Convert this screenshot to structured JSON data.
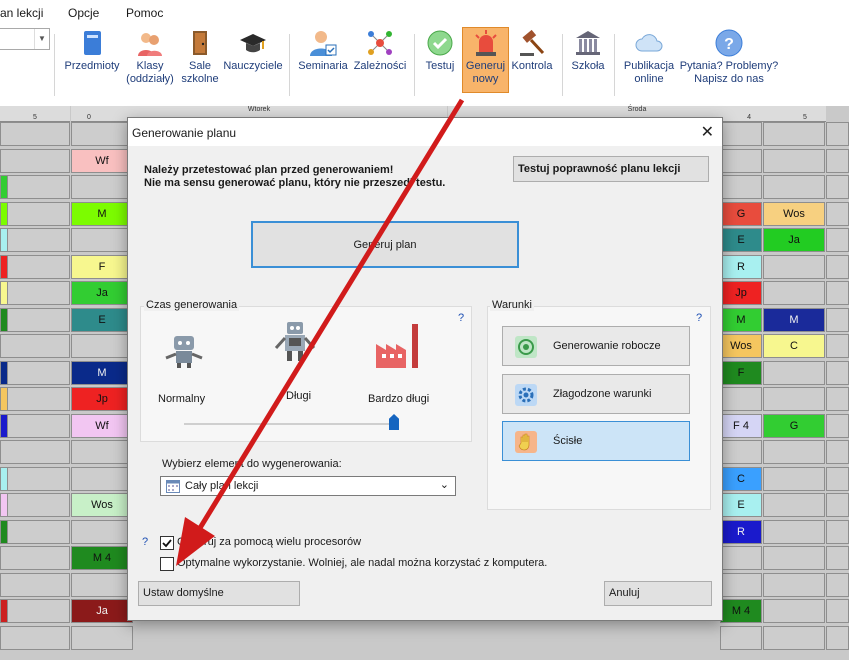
{
  "menubar": {
    "items": [
      "an lekcji",
      "Opcje",
      "Pomoc"
    ]
  },
  "ribbon": {
    "buttons": [
      {
        "label": "Przedmioty",
        "icon": "book-icon"
      },
      {
        "label": "Klasy\n(oddziały)",
        "icon": "students-icon"
      },
      {
        "label": "Sale\nszkolne",
        "icon": "door-icon"
      },
      {
        "label": "Nauczyciele",
        "icon": "graduation-cap-icon"
      },
      {
        "label": "Seminaria",
        "icon": "person-check-icon"
      },
      {
        "label": "Zależności",
        "icon": "network-icon"
      },
      {
        "label": "Testuj",
        "icon": "check-circle-icon"
      },
      {
        "label": "Generuj\nnowy",
        "icon": "alarm-light-icon"
      },
      {
        "label": "Kontrola",
        "icon": "gavel-icon"
      },
      {
        "label": "Szkoła",
        "icon": "building-icon"
      },
      {
        "label": "Publikacja\nonline",
        "icon": "cloud-icon"
      },
      {
        "label": "Pytania? Problemy?\nNapisz do nas",
        "icon": "question-icon"
      }
    ]
  },
  "grid": {
    "day_headers": [
      "Wtorek",
      "Środa"
    ],
    "period_headers": [
      "5",
      "0",
      "4",
      "5"
    ]
  },
  "cells_left": [
    {
      "text": "Wf",
      "color": "#f9c0c0"
    },
    {
      "text": "M",
      "color": "#7cfc00"
    },
    {
      "text": "F",
      "color": "#f7f78f"
    },
    {
      "text": "Ja",
      "color": "#32cd32"
    },
    {
      "text": "E",
      "color": "#2e8b8b"
    },
    {
      "text": "M",
      "color": "#0a2a8a"
    },
    {
      "text": "Jp",
      "color": "#ee2222"
    },
    {
      "text": "Wf",
      "color": "#f2c6f2"
    },
    {
      "text": "Wos",
      "color": "#c8f0c8"
    },
    {
      "text": "M 4",
      "color": "#1f8a1f"
    },
    {
      "text": "Ja",
      "color": "#8b1a1a"
    }
  ],
  "cells_right_a": [
    {
      "text": "G",
      "color": "#e84c3d"
    },
    {
      "text": "E",
      "color": "#2e8b8b"
    },
    {
      "text": "R",
      "color": "#a8f0f0"
    },
    {
      "text": "Jp",
      "color": "#ee2222"
    },
    {
      "text": "M",
      "color": "#32cd32"
    },
    {
      "text": "Wos",
      "color": "#f5c65f"
    },
    {
      "text": "F",
      "color": "#1f8a1f"
    },
    {
      "text": "F 4",
      "color": "#d5d5f5"
    },
    {
      "text": "C",
      "color": "#3aa0ff"
    },
    {
      "text": "E",
      "color": "#a8f0f0"
    },
    {
      "text": "R",
      "color": "#1a1acc"
    },
    {
      "text": "M 4",
      "color": "#1f8a1f"
    }
  ],
  "cells_right_b": [
    {
      "text": "Wos",
      "color": "#f7d080"
    },
    {
      "text": "Ja",
      "color": "#22cc22"
    },
    {
      "text": "M",
      "color": "#1a2a9a"
    },
    {
      "text": "C",
      "color": "#f7f78f"
    },
    {
      "text": "G",
      "color": "#32cd32"
    }
  ],
  "dialog": {
    "title": "Generowanie planu",
    "warning_line1": "Należy przetestować plan przed generowaniem!",
    "warning_line2": "Nie ma sensu generować planu, który nie przeszedł testu.",
    "test_button": "Testuj poprawność planu lekcji",
    "generate_button": "Generuj plan",
    "time_group": {
      "label": "Czas generowania",
      "help": "?",
      "options": [
        "Normalny",
        "Długi",
        "Bardzo długi"
      ],
      "selected_level": 1.0
    },
    "conditions_group": {
      "label": "Warunki",
      "help": "?",
      "options": [
        "Generowanie robocze",
        "Złagodzone warunki",
        "Ścisłe"
      ],
      "selected": "Ścisłe"
    },
    "element_label": "Wybierz element do wygenerowania:",
    "element_value": "Cały plan lekcji",
    "multi_cpu_help": "?",
    "multi_cpu_label": "Generuj za pomocą wielu procesorów",
    "multi_cpu_checked": true,
    "optimal_label": "Optymalne wykorzystanie. Wolniej, ale nadal można korzystać z komputera.",
    "optimal_checked": false,
    "defaults_button": "Ustaw domyślne",
    "cancel_button": "Anuluj"
  },
  "colors": {
    "accent": "#1565c0",
    "arrow": "#d11b1b",
    "active_button": "#f8b46a"
  }
}
